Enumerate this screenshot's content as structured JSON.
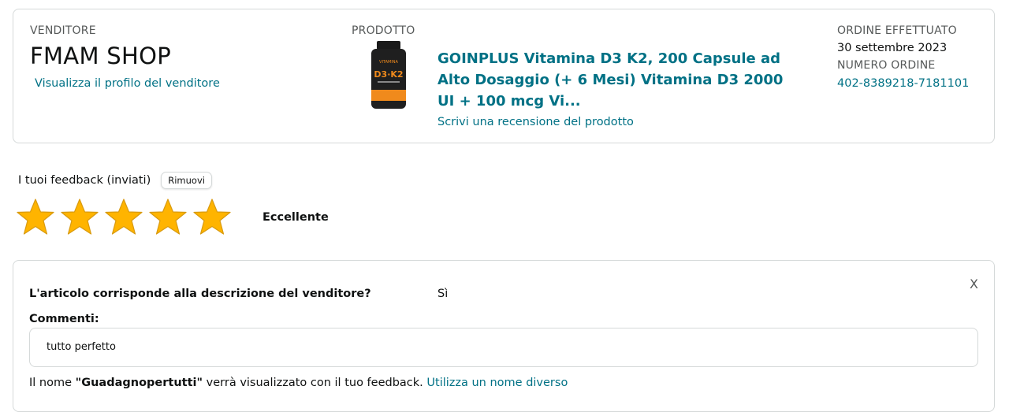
{
  "seller": {
    "label": "VENDITORE",
    "name": "FMAM SHOP",
    "profile_link": "Visualizza il profilo del venditore"
  },
  "product": {
    "label": "PRODOTTO",
    "title": "GOINPLUS Vitamina D3 K2, 200 Capsule ad Alto Dosaggio (+ 6 Mesi) Vitamina D3 2000 UI + 100 mcg Vi...",
    "review_link": "Scrivi una recensione del prodotto",
    "image_text_top": "VITAMINA",
    "image_text_main": "D3·K2"
  },
  "order": {
    "date_label": "ORDINE EFFETTUATO",
    "date": "30 settembre 2023",
    "number_label": "NUMERO ORDINE",
    "number": "402-8389218-7181101"
  },
  "feedback": {
    "label": "I tuoi feedback (inviati)",
    "remove_button": "Rimuovi",
    "rating": 5,
    "rating_max": 5,
    "rating_word": "Eccellente",
    "star_color": "#ffb400"
  },
  "details": {
    "close_label": "X",
    "question": "L'articolo corrisponde alla descrizione del venditore?",
    "answer": "Sì",
    "comments_label": "Commenti:",
    "comment": "tutto perfetto",
    "name_prefix": "Il nome ",
    "name_value": "\"Guadagnopertutti\"",
    "name_suffix": " verrà visualizzato con il tuo feedback.",
    "different_name_link": "Utilizza un nome diverso"
  },
  "colors": {
    "link": "#007185",
    "border": "#d5d9d9",
    "text": "#0f1111",
    "muted": "#565959"
  }
}
